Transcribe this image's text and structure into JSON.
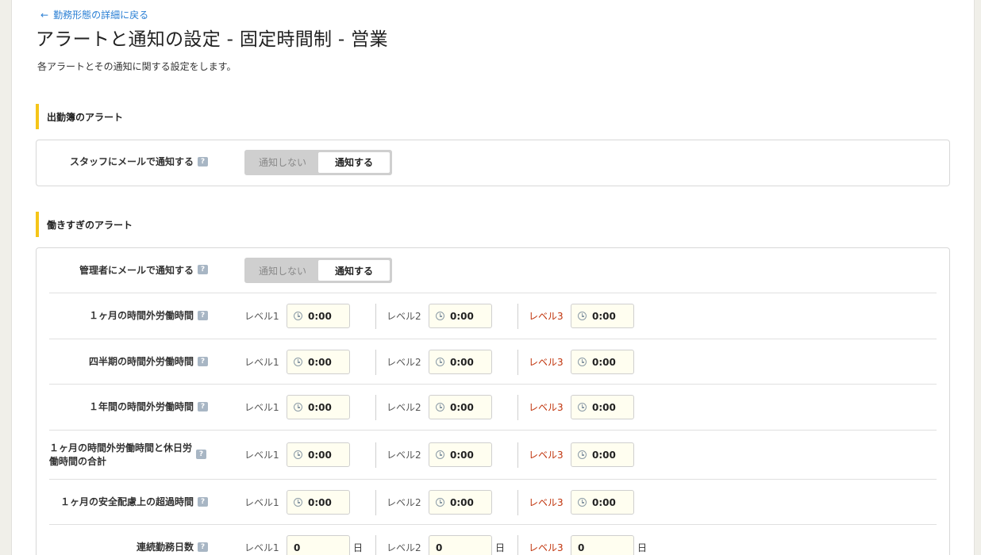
{
  "back_link": "勤務形態の詳細に戻る",
  "title": "アラートと通知の設定 - 固定時間制 - 営業",
  "description": "各アラートとその通知に関する設定をします。",
  "help_icon": "question-icon",
  "toggle_options": {
    "off": "通知しない",
    "on": "通知する"
  },
  "level_labels": [
    "レベル1",
    "レベル2",
    "レベル3"
  ],
  "level3_color": "#c0330b",
  "attendance_section": {
    "title": "出勤簿のアラート",
    "staff_email_label": "スタッフにメールで通知する",
    "staff_email_value": "通知する"
  },
  "overwork_section": {
    "title": "働きすぎのアラート",
    "manager_email_label": "管理者にメールで通知する",
    "manager_email_value": "通知する",
    "rows": [
      {
        "label": "１ヶ月の時間外労働時間",
        "values": [
          "0:00",
          "0:00",
          "0:00"
        ]
      },
      {
        "label": "四半期の時間外労働時間",
        "values": [
          "0:00",
          "0:00",
          "0:00"
        ]
      },
      {
        "label": "１年間の時間外労働時間",
        "values": [
          "0:00",
          "0:00",
          "0:00"
        ]
      },
      {
        "label_line1": "１ヶ月の時間外労働時間と休日労",
        "label_line2": "働時間の合計",
        "values": [
          "0:00",
          "0:00",
          "0:00"
        ]
      },
      {
        "label": "１ヶ月の安全配慮上の超過時間",
        "values": [
          "0:00",
          "0:00",
          "0:00"
        ]
      }
    ],
    "consecutive": {
      "label": "連続勤務日数",
      "values": [
        "0",
        "0",
        "0"
      ],
      "unit": "日"
    }
  }
}
